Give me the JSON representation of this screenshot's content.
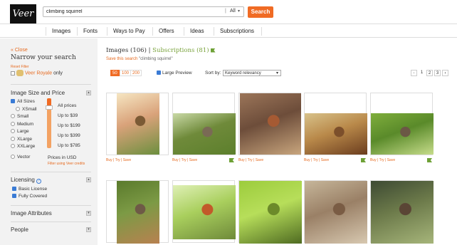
{
  "brand": {
    "logo_text": "Veer",
    "accent": "#f06b24"
  },
  "search": {
    "query": "climbing squirrel",
    "scope": "All",
    "button": "Search"
  },
  "nav": {
    "items": [
      "Images",
      "Fonts",
      "Ways to Pay",
      "Offers",
      "Ideas",
      "Subscriptions"
    ]
  },
  "sidebar": {
    "close": "« Close",
    "heading": "Narrow your search",
    "reset": "Reset Filter",
    "royale_pre": "Veer Royale",
    "royale_post": " only",
    "size_price": {
      "title": "Image Size and Price",
      "sizes": [
        "All Sizes",
        "XSmall",
        "Small",
        "Medium",
        "Large",
        "XLarge",
        "XXLarge",
        "Vector"
      ],
      "selected_size": "All Sizes",
      "prices": [
        "All prices",
        "Up to $39",
        "Up to $199",
        "Up to $399",
        "Up to $785"
      ],
      "selected_price": "All prices",
      "currency": "Prices in USD",
      "credits_link": "Filter using Veer credits"
    },
    "licensing": {
      "title": "Licensing",
      "help": "?",
      "options": [
        "Basic License",
        "Fully Covered"
      ]
    },
    "attributes": {
      "title": "Image Attributes"
    },
    "people": {
      "title": "People"
    }
  },
  "results": {
    "label": "Images",
    "count": "(106)",
    "sep": " | ",
    "subs_label": "Subscriptions",
    "subs_count": "(81)",
    "save_link": "Save this search",
    "save_query": " \"climbing squirrel\"",
    "per_page": [
      "50",
      "100",
      "200"
    ],
    "per_page_selected": "50",
    "large_preview": "Large Preview",
    "sort_label": "Sort by:",
    "sort_value": "Keyword relevancy",
    "pages": [
      "1",
      "2",
      "3"
    ],
    "current_page": "1",
    "actions": "Buy | Try | Save"
  },
  "thumbnails": [
    {
      "name": "squirrel-sunlit-trunk",
      "colors": [
        "#f6e6c2",
        "#d9a27a",
        "#7b5a35",
        "#6c8f3e"
      ]
    },
    {
      "name": "squirrel-on-grass",
      "colors": [
        "#c9d9a6",
        "#6f8a3a",
        "#7a6a55",
        "#5c7f2c"
      ]
    },
    {
      "name": "squirrel-on-tree-trunk",
      "colors": [
        "#9b7559",
        "#6d4d3a",
        "#a55a33",
        "#c8a57d"
      ]
    },
    {
      "name": "squirrel-facing-camera",
      "colors": [
        "#d8c28a",
        "#b9894a",
        "#7c4f2b",
        "#6b3d1e"
      ]
    },
    {
      "name": "squirrel-on-trunk-green",
      "colors": [
        "#7fae3c",
        "#5a8a2a",
        "#6b5845",
        "#c6dc8a"
      ]
    },
    {
      "name": "squirrel-climbing-bark",
      "colors": [
        "#5a7a2c",
        "#7c9a45",
        "#6e5a46",
        "#b88150"
      ]
    },
    {
      "name": "two-squirrels-on-branch",
      "colors": [
        "#dff0b6",
        "#a9cf5d",
        "#c25a2a",
        "#6f8a3a"
      ]
    },
    {
      "name": "squirrel-upside-down-green",
      "colors": [
        "#9ccc3c",
        "#b7de5a",
        "#6c8a2a",
        "#4f6b22"
      ]
    },
    {
      "name": "squirrel-on-log",
      "colors": [
        "#c6b69a",
        "#9a8066",
        "#7a5c44",
        "#d7c8b0"
      ]
    },
    {
      "name": "squirrel-on-dark-trunk",
      "colors": [
        "#3d4a33",
        "#6c7a4a",
        "#5a4535",
        "#a6b57a"
      ]
    }
  ]
}
